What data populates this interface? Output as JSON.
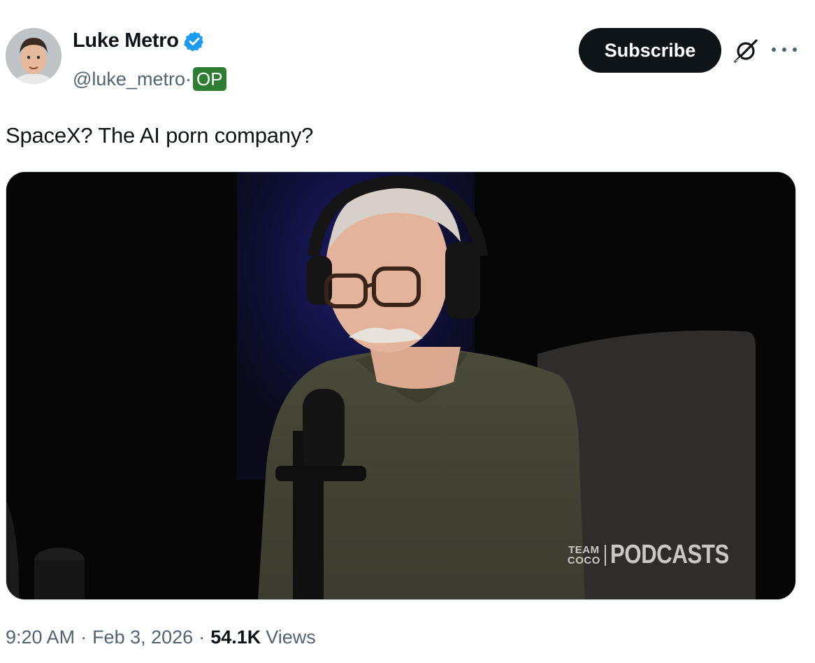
{
  "author": {
    "display_name": "Luke Metro",
    "handle": "@luke_metro",
    "handle_separator": "·",
    "op_badge": "OP",
    "verified_icon": "verified-badge-icon",
    "avatar_icon": "avatar"
  },
  "header": {
    "subscribe_label": "Subscribe",
    "grok_icon": "grok-icon",
    "more_icon": "more-icon"
  },
  "tweet": {
    "text": "SpaceX? The AI porn company?"
  },
  "media": {
    "watermark_small_top": "TEAM",
    "watermark_small_bottom": "COCO",
    "watermark_big": "PODCASTS"
  },
  "meta": {
    "time": "9:20 AM",
    "separator": "·",
    "date": "Feb 3, 2026",
    "views_count": "54.1K",
    "views_label": "Views"
  },
  "colors": {
    "accent_verified": "#1d9bf0",
    "op_badge_bg": "#2e7d32",
    "subscribe_bg": "#0f1419",
    "secondary_text": "#536471"
  }
}
